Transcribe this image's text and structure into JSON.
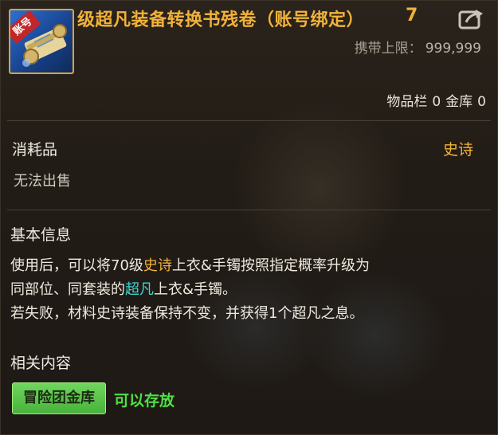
{
  "item": {
    "tag": "账号",
    "title": "级超凡装备转换书残卷（账号绑定）",
    "title_suffix": "7",
    "carry_label": "携带上限：",
    "carry_value": "999,999"
  },
  "storage": {
    "inventory_label": "物品栏",
    "inventory_count": "0",
    "vault_label": "金库",
    "vault_count": "0"
  },
  "category": {
    "type": "消耗品",
    "rarity": "史诗",
    "sell_note": "无法出售"
  },
  "basic_info": {
    "heading": "基本信息",
    "line1_a": "使用后，可以将70级",
    "line1_epic": "史诗",
    "line1_b": "上衣&手镯按照指定概率升级为",
    "line2_a": "同部位、同套装的",
    "line2_super": "超凡",
    "line2_b": "上衣&手镯。",
    "line3": "若失败，材料史诗装备保持不变，并获得1个超凡之息。"
  },
  "related": {
    "heading": "相关内容",
    "button_label": "冒险团金库",
    "status": "可以存放"
  },
  "colors": {
    "title": "#f1b23a",
    "epic": "#f1b23a",
    "super": "#3fd6d2",
    "storable": "#4fe046",
    "button": "#5cc64a"
  }
}
